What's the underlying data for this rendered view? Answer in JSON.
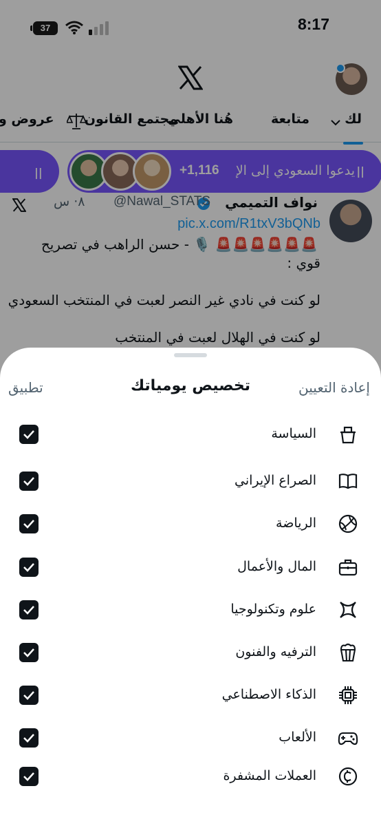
{
  "status_bar": {
    "time": "8:17",
    "battery": "37"
  },
  "tabs": [
    {
      "label": "لك",
      "selected": true
    },
    {
      "label": "متابعة"
    },
    {
      "label": "هُنا الأهلي"
    },
    {
      "label": "مجتمع القانون"
    },
    {
      "label": "عروض و"
    }
  ],
  "spaces": {
    "text": "يدعوا السعودي إلى الإ",
    "count": "+1,116"
  },
  "tweet": {
    "author": "نواف التميمي",
    "handle": "@Nawal_STATS",
    "time": "٨· س",
    "link": "pic.x.com/R1txV3bQNb",
    "line1": "🚨🚨🚨🚨🚨🚨 🎙️ - حسن الراهب في تصريح",
    "line2": "قوي :",
    "line3": "لو كنت في نادي غير النصر لعبت في المنتخب السعودي",
    "line4": "لو كنت في الهلال لعبت في المنتخب"
  },
  "sheet": {
    "title": "تخصيص يومياتك",
    "reset_label": "إعادة التعيين",
    "apply_label": "تطبيق",
    "rows": [
      {
        "label": "السياسة",
        "icon": "ballot-box-icon",
        "checked": true
      },
      {
        "label": "الصراع الإيراني",
        "icon": "book-icon",
        "checked": true
      },
      {
        "label": "الرياضة",
        "icon": "ball-icon",
        "checked": true
      },
      {
        "label": "المال والأعمال",
        "icon": "briefcase-icon",
        "checked": true
      },
      {
        "label": "علوم وتكنولوجيا",
        "icon": "science-icon",
        "checked": true
      },
      {
        "label": "الترفيه والفنون",
        "icon": "popcorn-icon",
        "checked": true
      },
      {
        "label": "الذكاء الاصطناعي",
        "icon": "chip-icon",
        "checked": true
      },
      {
        "label": "الألعاب",
        "icon": "gamepad-icon",
        "checked": true
      },
      {
        "label": "العملات المشفرة",
        "icon": "crypto-coin-icon",
        "checked": true
      }
    ]
  },
  "colors": {
    "accent": "#1d9bf0",
    "spaces_purple": "#7856ff",
    "text": "#0f1419",
    "secondary": "#536471"
  }
}
